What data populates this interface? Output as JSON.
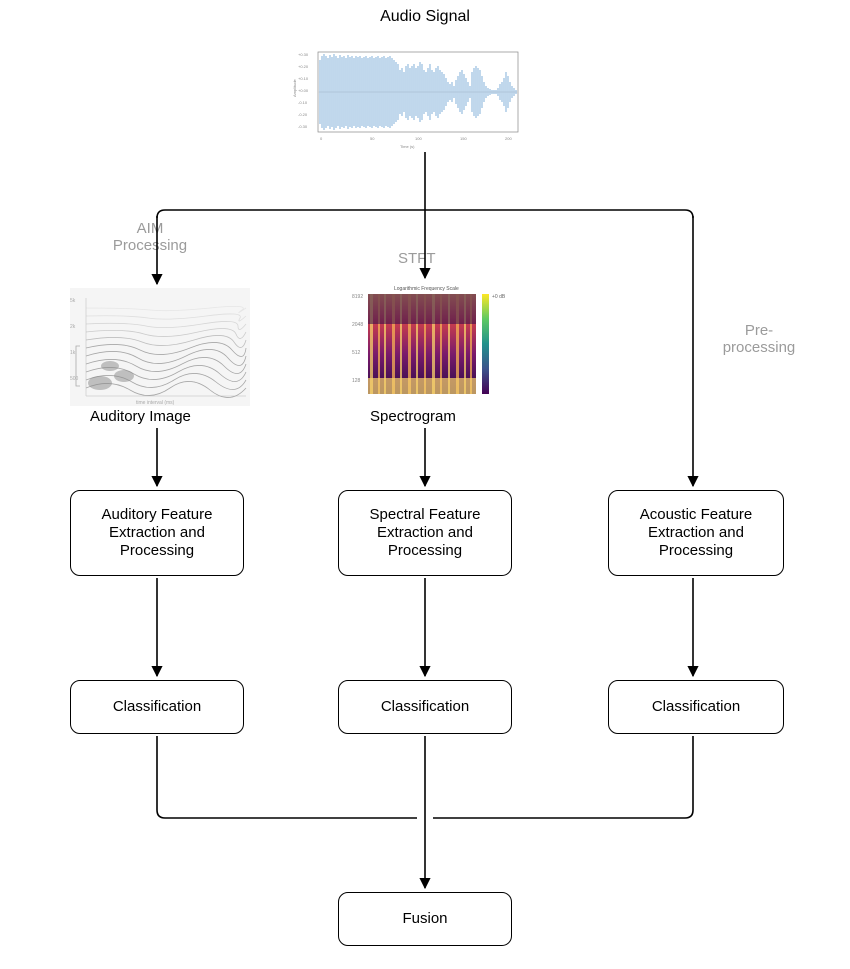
{
  "title": "Audio Signal",
  "edges": {
    "aim": "AIM\nProcessing",
    "stft": "STFT",
    "pre": "Pre-\nprocessing"
  },
  "thumbnails": {
    "waveform_caption": "",
    "auditory_caption": "Auditory Image",
    "spectrogram_caption": "Spectrogram",
    "spectrogram_title": "Logarithmic Frequency Scale",
    "spectrogram_cbar": "+0 dB"
  },
  "branches": {
    "left": {
      "feature": "Auditory Feature\nExtraction and\nProcessing",
      "classify": "Classification"
    },
    "mid": {
      "feature": "Spectral Feature\nExtraction and\nProcessing",
      "classify": "Classification"
    },
    "right": {
      "feature": "Acoustic Feature\nExtraction and\nProcessing",
      "classify": "Classification"
    }
  },
  "fusion": "Fusion"
}
